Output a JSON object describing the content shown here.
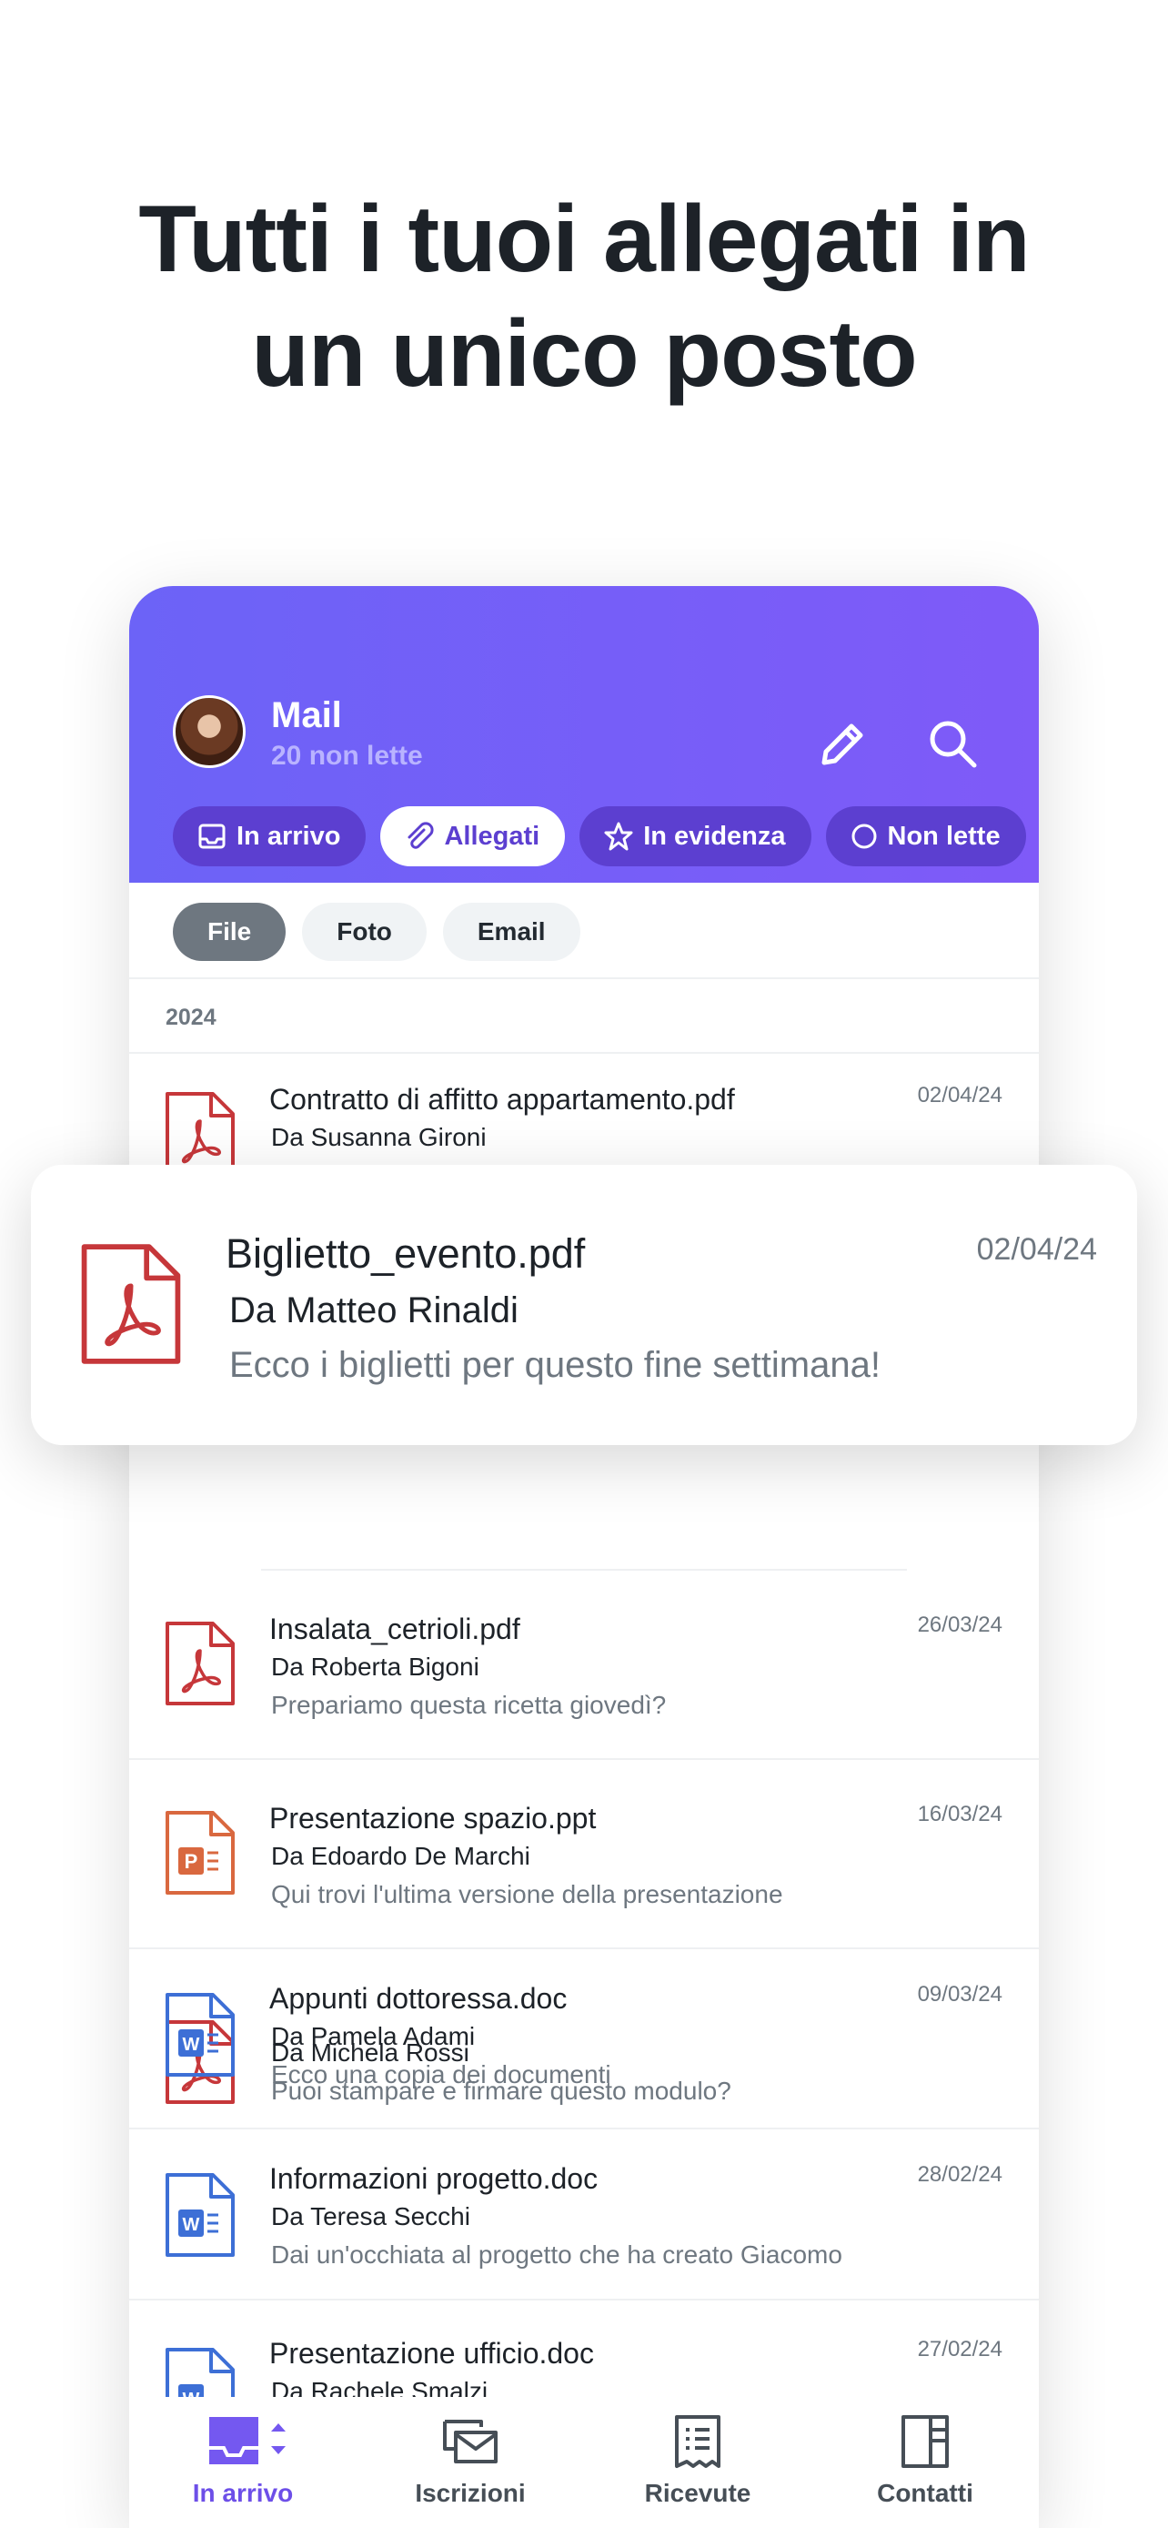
{
  "headline": {
    "line1": "Tutti i tuoi allegati in",
    "line2": "un unico posto"
  },
  "header": {
    "title": "Mail",
    "unread": "20 non lette",
    "compose_icon": "pencil-icon",
    "search_icon": "search-icon"
  },
  "tabs": [
    {
      "label": "In arrivo",
      "icon": "inbox-icon",
      "active": false
    },
    {
      "label": "Allegati",
      "icon": "paperclip-icon",
      "active": true
    },
    {
      "label": "In evidenza",
      "icon": "star-icon",
      "active": false
    },
    {
      "label": "Non lette",
      "icon": "circle-icon",
      "active": false
    }
  ],
  "filters": [
    {
      "label": "File",
      "active": true
    },
    {
      "label": "Foto",
      "active": false
    },
    {
      "label": "Email",
      "active": false
    }
  ],
  "section_year": "2024",
  "items": [
    {
      "name": "Contratto di affitto appartamento.pdf",
      "sender": "Da Susanna Gironi",
      "snippet": "",
      "date": "02/04/24",
      "type": "pdf"
    },
    {
      "name": "",
      "sender": "Da Michela Rossi",
      "snippet": "Puoi stampare e firmare questo modulo?",
      "date": "",
      "type": "pdf"
    },
    {
      "name": "Insalata_cetrioli.pdf",
      "sender": "Da Roberta Bigoni",
      "snippet": "Prepariamo questa ricetta giovedì?",
      "date": "26/03/24",
      "type": "pdf"
    },
    {
      "name": "Presentazione spazio.ppt",
      "sender": "Da Edoardo De Marchi",
      "snippet": "Qui trovi l'ultima versione della presentazione",
      "date": "16/03/24",
      "type": "ppt"
    },
    {
      "name": "Appunti dottoressa.doc",
      "sender": "Da Pamela Adami",
      "snippet": "Ecco una copia dei documenti",
      "date": "09/03/24",
      "type": "doc"
    },
    {
      "name": "Informazioni progetto.doc",
      "sender": "Da Teresa Secchi",
      "snippet": "Dai un'occhiata al progetto che ha creato Giacomo",
      "date": "28/02/24",
      "type": "doc"
    },
    {
      "name": "Presentazione ufficio.doc",
      "sender": "Da Rachele Smalzi",
      "snippet": "",
      "date": "27/02/24",
      "type": "doc"
    }
  ],
  "highlight": {
    "name": "Biglietto_evento.pdf",
    "sender": "Da Matteo Rinaldi",
    "snippet": "Ecco i biglietti per questo fine settimana!",
    "date": "02/04/24",
    "type": "pdf"
  },
  "bottom_nav": [
    {
      "label": "In arrivo",
      "icon": "inbox-tray-icon",
      "active": true
    },
    {
      "label": "Iscrizioni",
      "icon": "subscriptions-icon",
      "active": false
    },
    {
      "label": "Ricevute",
      "icon": "receipt-icon",
      "active": false
    },
    {
      "label": "Contatti",
      "icon": "contacts-icon",
      "active": false
    }
  ],
  "colors": {
    "header_gradient_start": "#6c63f7",
    "header_gradient_end": "#7f5af8",
    "chip_bg": "#5c3fd0",
    "pdf_red": "#c6373a",
    "ppt_orange": "#d9683f",
    "doc_blue": "#3d6fd6",
    "nav_active": "#6d4fe8"
  }
}
